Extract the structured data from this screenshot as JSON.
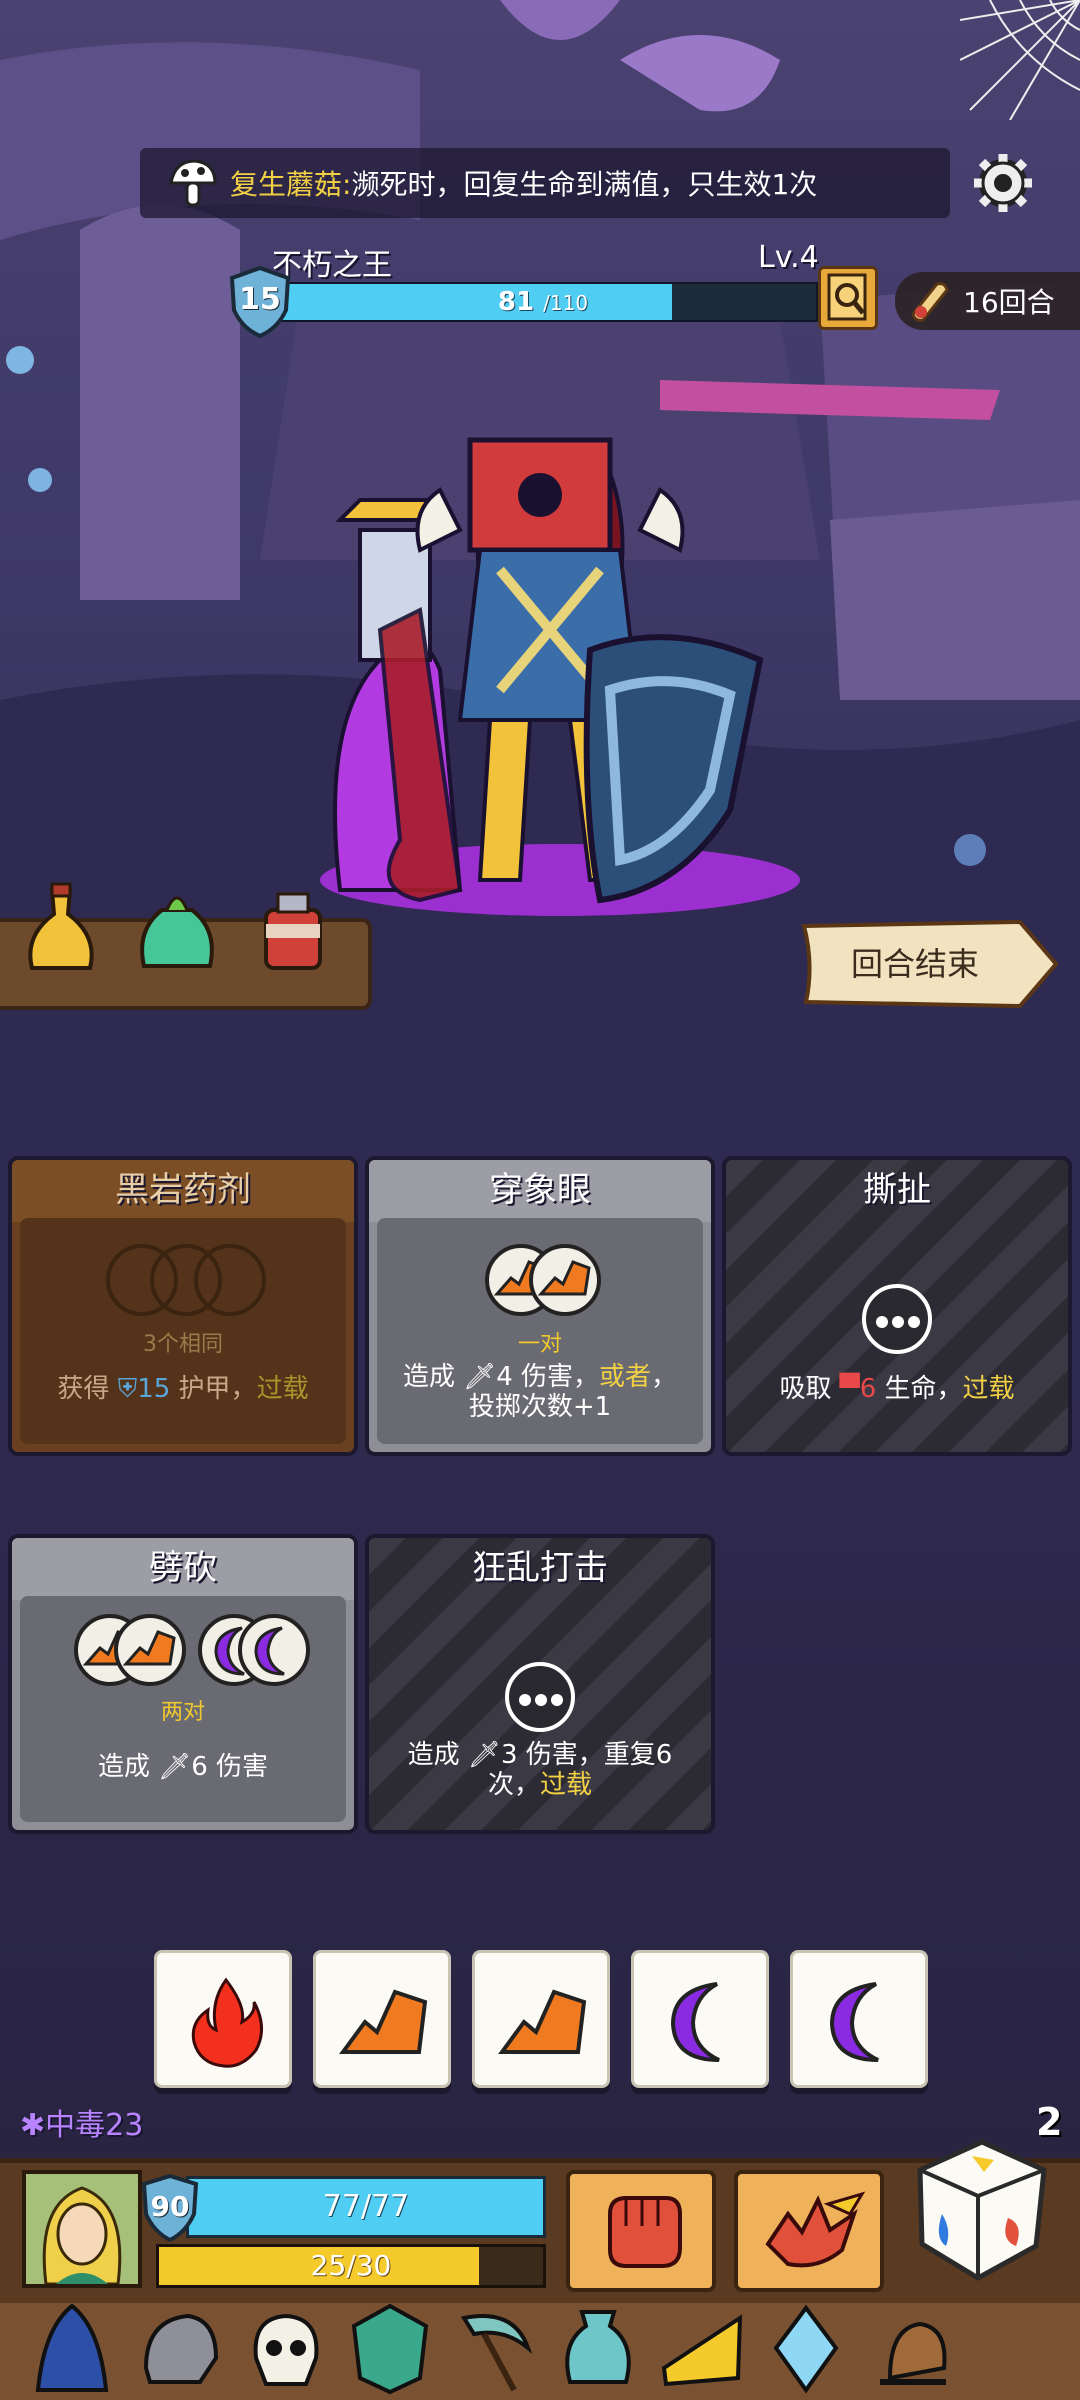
{
  "banner": {
    "item_name": "复生蘑菇:",
    "item_desc": " 濒死时，回复生命到满值，只生效1次"
  },
  "boss": {
    "name": "不朽之王",
    "level": "Lv.4",
    "armor": "15",
    "hp_current": "81",
    "hp_max": "/110",
    "hp_fraction": 0.736
  },
  "rounds": "16回合",
  "end_turn": "回合结束",
  "cards": [
    {
      "title": "黑岩药剂",
      "requirement": "3个相同",
      "desc_a": "获得 ",
      "desc_value": "15",
      "desc_b": " 护甲，",
      "desc_c": "过载"
    },
    {
      "title": "穿象眼",
      "requirement": "一对",
      "desc_a": "造成 ",
      "desc_value": "4",
      "desc_b": " 伤害，",
      "desc_c": "或者",
      "desc_d": "，投掷次数+1"
    },
    {
      "title": "撕扯",
      "desc_a": "吸取 ",
      "desc_value": "6",
      "desc_b": " 生命，",
      "desc_c": "过载"
    },
    {
      "title": "劈砍",
      "requirement": "两对",
      "desc_a": "造成 ",
      "desc_value": "6",
      "desc_b": " 伤害"
    },
    {
      "title": "狂乱打击",
      "desc_a": "造成 ",
      "desc_value": "3",
      "desc_b": " 伤害，重复6次，",
      "desc_c": "过载"
    }
  ],
  "dice": [
    "fire-icon",
    "rock-icon",
    "rock-icon",
    "moon-icon",
    "moon-icon"
  ],
  "status": "中毒23",
  "dice_remaining": "2",
  "player": {
    "armor": "90",
    "hp": "77/77",
    "energy": "25/30",
    "energy_fraction": 0.833
  },
  "colors": {
    "hp_blue": "#4fcdf2",
    "energy_yellow": "#f5cb2b",
    "highlight_yellow": "#f2d044",
    "poison_purple": "#b883ff"
  }
}
